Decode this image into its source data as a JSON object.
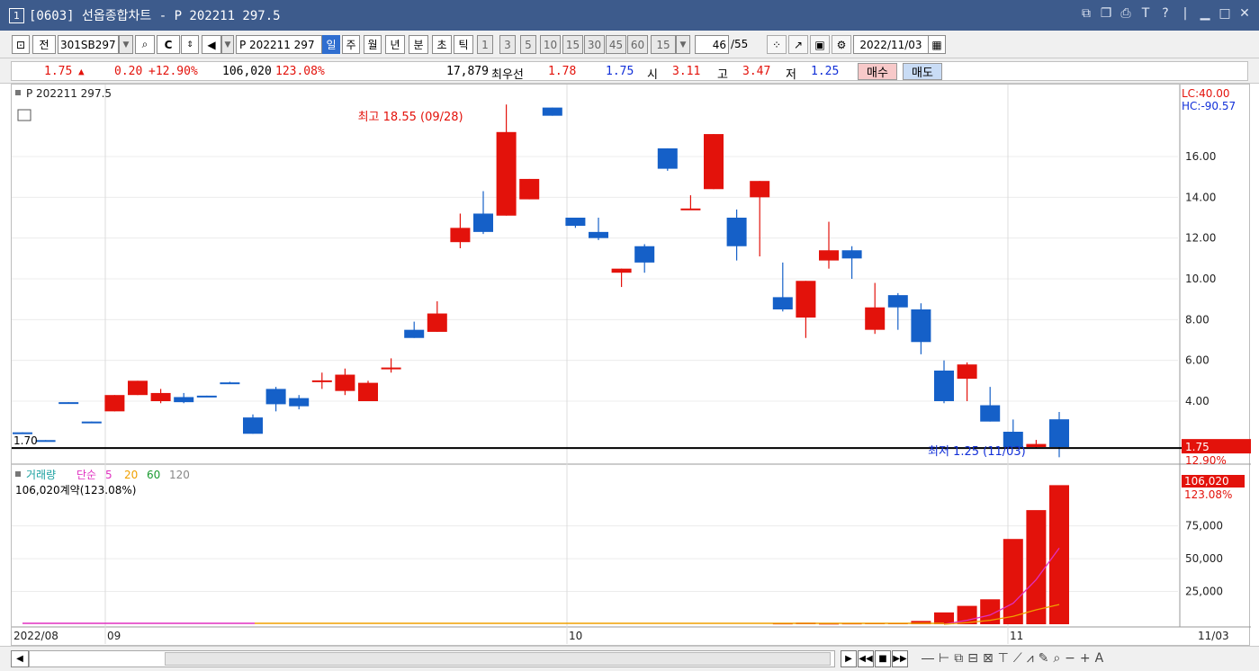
{
  "window": {
    "number": "1",
    "title": "[0603] 선옵종합차트 - P 202211 297.5"
  },
  "toolbar": {
    "jeon_label": "전",
    "code_value": "301SB297",
    "cc_label": "C",
    "symbol_value": "P 202211 297",
    "period_tabs": [
      "일",
      "주",
      "월",
      "년",
      "분",
      "초",
      "틱"
    ],
    "selected_tab": "일",
    "interval_options": [
      "1",
      "3",
      "5",
      "10",
      "15",
      "30",
      "45",
      "60"
    ],
    "interval_value": "15",
    "count_value": "46",
    "count_total": "/55",
    "date_value": "2022/11/03"
  },
  "quote": {
    "price": "1.75",
    "arrow": "▲",
    "change": "0.20",
    "change_pct": "+12.90%",
    "volume": "106,020",
    "volume_pct": "123.08%",
    "bid_qty": "17,879",
    "best_label": "최우선",
    "best_ask": "1.78",
    "best_bid": "1.75",
    "open_label": "시",
    "open": "3.11",
    "high_label": "고",
    "high": "3.47",
    "low_label": "저",
    "low": "1.25",
    "buy_label": "매수",
    "sell_label": "매도"
  },
  "chart": {
    "price_legend": "P 202211 297.5",
    "lc_label": "LC:40.00",
    "hc_label": "HC:-90.57",
    "max_annotation": "최고 18.55 (09/28)",
    "min_annotation": "최저 1.25 (11/03)",
    "hline_label": "1.70",
    "last_price_badge": "1.75",
    "last_pct_badge": "12.90%",
    "volume_legend": {
      "name": "거래량",
      "ma_label": "단순",
      "periods": [
        "5",
        "20",
        "60",
        "120"
      ]
    },
    "volume_info": "106,020계약(123.08%)",
    "last_volume_badge": "106,020",
    "last_volume_pct": "123.08%",
    "date_labels": [
      "2022/08",
      "09",
      "10",
      "11",
      "11/03"
    ],
    "colors": {
      "up": "#e3120b",
      "down": "#1560c8",
      "ma5": "#e030c0",
      "ma20": "#f0a000"
    }
  },
  "chart_data": [
    {
      "type": "candlestick",
      "title": "P 202211 297.5",
      "y_tick_labels": [
        "4.00",
        "6.00",
        "8.00",
        "10.00",
        "12.00",
        "14.00",
        "16.00"
      ],
      "ylim": [
        1.0,
        19.0
      ],
      "candles": [
        {
          "o": 2.47,
          "h": 2.47,
          "l": 2.43,
          "c": 2.43
        },
        {
          "o": 2.09,
          "h": 2.09,
          "l": 2.05,
          "c": 2.05
        },
        {
          "o": 3.95,
          "h": 3.95,
          "l": 3.91,
          "c": 3.91
        },
        {
          "o": 3.0,
          "h": 3.0,
          "l": 2.96,
          "c": 2.96
        },
        {
          "o": 3.5,
          "h": 4.3,
          "l": 3.5,
          "c": 4.3
        },
        {
          "o": 4.3,
          "h": 5.0,
          "l": 4.3,
          "c": 5.0
        },
        {
          "o": 4.0,
          "h": 4.6,
          "l": 3.9,
          "c": 4.4
        },
        {
          "o": 4.2,
          "h": 4.4,
          "l": 3.9,
          "c": 3.95
        },
        {
          "o": 4.27,
          "h": 4.27,
          "l": 4.23,
          "c": 4.23
        },
        {
          "o": 4.92,
          "h": 4.95,
          "l": 4.85,
          "c": 4.88
        },
        {
          "o": 3.2,
          "h": 3.35,
          "l": 2.4,
          "c": 2.4
        },
        {
          "o": 4.6,
          "h": 4.7,
          "l": 3.5,
          "c": 3.85
        },
        {
          "o": 4.15,
          "h": 4.3,
          "l": 3.6,
          "c": 3.75
        },
        {
          "o": 4.98,
          "h": 5.4,
          "l": 4.6,
          "c": 5.02
        },
        {
          "o": 4.5,
          "h": 5.6,
          "l": 4.3,
          "c": 5.3
        },
        {
          "o": 4.0,
          "h": 5.0,
          "l": 4.0,
          "c": 4.9
        },
        {
          "o": 5.6,
          "h": 6.1,
          "l": 5.4,
          "c": 5.65
        },
        {
          "o": 7.5,
          "h": 7.9,
          "l": 7.1,
          "c": 7.1
        },
        {
          "o": 7.4,
          "h": 8.9,
          "l": 7.4,
          "c": 8.3
        },
        {
          "o": 11.8,
          "h": 13.2,
          "l": 11.5,
          "c": 12.5
        },
        {
          "o": 13.2,
          "h": 14.3,
          "l": 12.2,
          "c": 12.3
        },
        {
          "o": 13.1,
          "h": 18.55,
          "l": 13.1,
          "c": 17.2
        },
        {
          "o": 13.9,
          "h": 14.9,
          "l": 13.9,
          "c": 14.9
        },
        {
          "o": 18.4,
          "h": 18.4,
          "l": 18.0,
          "c": 18.0
        },
        {
          "o": 13.0,
          "h": 13.0,
          "l": 12.5,
          "c": 12.6
        },
        {
          "o": 12.3,
          "h": 13.0,
          "l": 11.9,
          "c": 12.0
        },
        {
          "o": 10.3,
          "h": 10.5,
          "l": 9.6,
          "c": 10.5
        },
        {
          "o": 11.6,
          "h": 11.7,
          "l": 10.3,
          "c": 10.8
        },
        {
          "o": 16.4,
          "h": 16.4,
          "l": 15.3,
          "c": 15.4
        },
        {
          "o": 13.45,
          "h": 14.1,
          "l": 13.4,
          "c": 13.45
        },
        {
          "o": 14.4,
          "h": 17.1,
          "l": 14.4,
          "c": 17.1
        },
        {
          "o": 13.0,
          "h": 13.4,
          "l": 10.9,
          "c": 11.6
        },
        {
          "o": 14.0,
          "h": 14.8,
          "l": 11.1,
          "c": 14.8
        },
        {
          "o": 9.1,
          "h": 10.8,
          "l": 8.4,
          "c": 8.5
        },
        {
          "o": 8.1,
          "h": 9.9,
          "l": 7.1,
          "c": 9.9
        },
        {
          "o": 10.9,
          "h": 12.8,
          "l": 10.5,
          "c": 11.4
        },
        {
          "o": 11.4,
          "h": 11.6,
          "l": 10.0,
          "c": 11.0
        },
        {
          "o": 7.5,
          "h": 9.8,
          "l": 7.3,
          "c": 8.6
        },
        {
          "o": 9.2,
          "h": 9.3,
          "l": 7.5,
          "c": 8.6
        },
        {
          "o": 8.5,
          "h": 8.8,
          "l": 6.3,
          "c": 6.9
        },
        {
          "o": 5.5,
          "h": 6.0,
          "l": 3.9,
          "c": 4.0
        },
        {
          "o": 5.1,
          "h": 5.9,
          "l": 4.0,
          "c": 5.8
        },
        {
          "o": 3.8,
          "h": 4.7,
          "l": 3.0,
          "c": 3.0
        },
        {
          "o": 2.5,
          "h": 3.1,
          "l": 1.75,
          "c": 1.75
        },
        {
          "o": 1.75,
          "h": 2.1,
          "l": 1.7,
          "c": 1.9
        },
        {
          "o": 3.11,
          "h": 3.47,
          "l": 1.25,
          "c": 1.75
        }
      ]
    },
    {
      "type": "bar",
      "title": "거래량",
      "y_tick_labels": [
        "25,000",
        "50,000",
        "75,000"
      ],
      "ylim": [
        0,
        120000
      ],
      "values": [
        0,
        0,
        0,
        0,
        0,
        0,
        0,
        0,
        0,
        0,
        0,
        0,
        0,
        0,
        0,
        0,
        0,
        0,
        0,
        0,
        0,
        0,
        0,
        0,
        0,
        0,
        0,
        0,
        0,
        0,
        0,
        0,
        0,
        600,
        1200,
        500,
        600,
        800,
        1000,
        2500,
        9000,
        14000,
        19000,
        65000,
        87000,
        106020
      ],
      "up_flags": [
        1,
        1,
        1,
        1,
        1,
        1,
        1,
        1,
        1,
        1,
        1,
        1,
        1,
        1,
        1,
        1,
        1,
        1,
        1,
        1,
        1,
        1,
        1,
        1,
        1,
        1,
        1,
        1,
        1,
        1,
        1,
        1,
        1,
        1,
        1,
        1,
        1,
        1,
        1,
        1,
        1,
        1,
        1,
        1,
        1,
        1
      ],
      "ma5_tail": [
        0,
        3000,
        7000,
        16000,
        34000,
        58000
      ],
      "ma20_tail": [
        0,
        1200,
        3000,
        6000,
        11000,
        15000
      ]
    }
  ]
}
